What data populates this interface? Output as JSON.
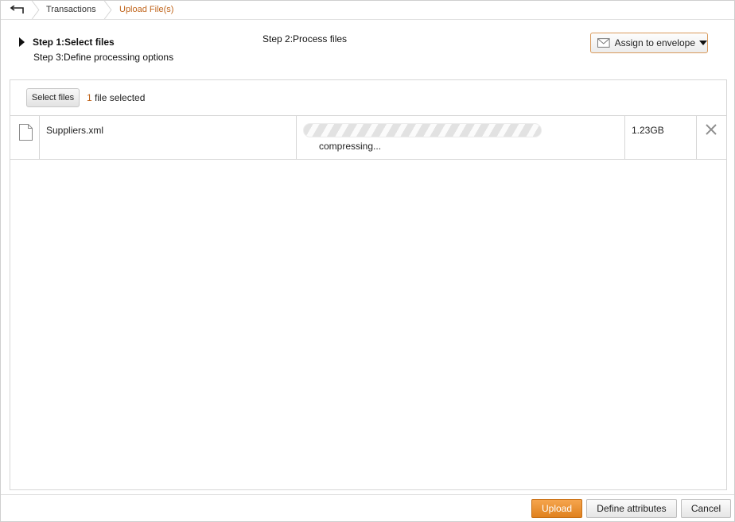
{
  "breadcrumb": {
    "back_icon": "back-arrow-icon",
    "items": [
      {
        "label": "Transactions"
      },
      {
        "label": "Upload File(s)"
      }
    ]
  },
  "steps": {
    "step1": "Step 1:Select files",
    "step2": "Step 2:Process files",
    "step3": "Step 3:Define processing options",
    "active": 1
  },
  "assign": {
    "icon": "envelope-icon",
    "label": "Assign to envelope"
  },
  "toolbar": {
    "select_label": "Select files",
    "count": "1",
    "count_suffix": " file selected"
  },
  "files": [
    {
      "icon": "document-icon",
      "name": "Suppliers.xml",
      "status": "compressing...",
      "size": "1.23GB",
      "delete_icon": "close-icon"
    }
  ],
  "footer": {
    "upload_label": "Upload",
    "define_label": "Define attributes",
    "cancel_label": "Cancel"
  },
  "colors": {
    "accent": "#c0651c",
    "primary_button": "#e98f2c",
    "border": "#d6d6d6"
  }
}
